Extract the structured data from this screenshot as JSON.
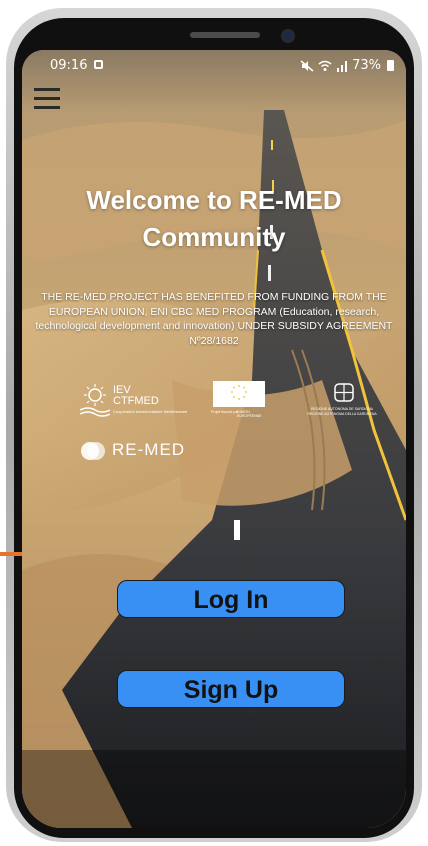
{
  "status_bar": {
    "time": "09:16",
    "battery": "73%",
    "icons": [
      "notification-icon",
      "mute-icon",
      "wifi-icon",
      "signal-icon",
      "battery-icon"
    ]
  },
  "menu": {
    "icon": "hamburger-menu-icon"
  },
  "welcome": {
    "line1": "Welcome to RE-MED",
    "line2": "Community"
  },
  "funding_text": "THE RE-MED PROJECT HAS BENEFITED FROM FUNDING FROM THE EUROPEAN UNION, ENI CBC MED PROGRAM (Education, research, technological development and innovation) UNDER SUBSIDY AGREEMENT Nº28/1682",
  "logos": {
    "iev": {
      "line1": "IEV",
      "line2": "CTFMED",
      "small": "Coopération transfrontalière Méditerranée"
    },
    "eu": {
      "caption_left": "Projet financé par",
      "caption_right": "l'UNION EUROPÉENNE"
    },
    "sardegna": {
      "line1": "REGIONE AUTONOMA DE SARDIGNA",
      "line2": "REGIONE AUTONOMA DELLA SARDEGNA"
    },
    "remed": {
      "text": "RE-MED"
    }
  },
  "buttons": {
    "login": "Log In",
    "signup": "Sign Up"
  },
  "colors": {
    "button": "#3990f4",
    "accent_line": "#e8722c",
    "sand": "#c9a36d",
    "road": "#2e2f33"
  }
}
